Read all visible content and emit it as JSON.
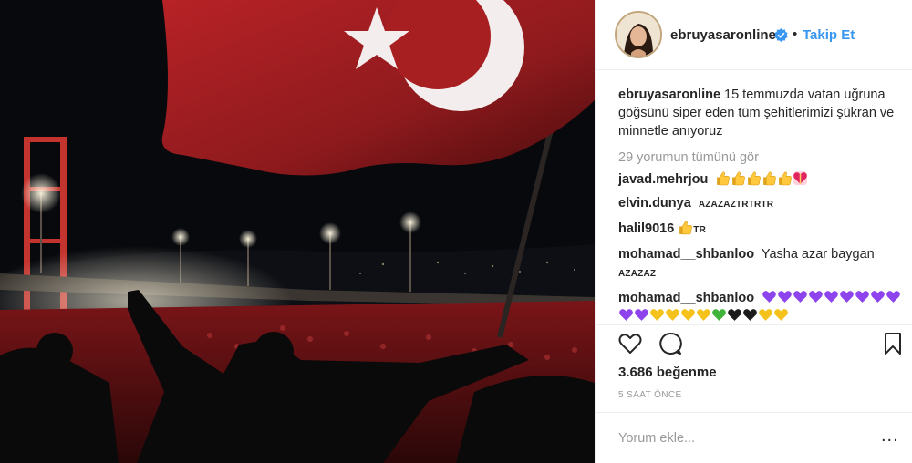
{
  "post": {
    "image_alt": "Turkish flag waved over a crowd on the bridge at night"
  },
  "header": {
    "username": "ebruyasaronline",
    "dot": "•",
    "follow_label": "Takip Et"
  },
  "caption": {
    "username": "ebruyasaronline",
    "text": "15 temmuzda vatan uğruna göğsünü siper eden tüm şehitlerimizi şükran ve minnetle anıyoruz"
  },
  "view_all_comments": "29 yorumun tümünü gör",
  "comments": [
    {
      "username": "javad.mehrjou",
      "text": "",
      "emojis": [
        "thumbs-up",
        "thumbs-up",
        "thumbs-up",
        "thumbs-up",
        "thumbs-up",
        "heart-ribbon"
      ]
    },
    {
      "username": "elvin.dunya",
      "text": "AZAZAZTRTRTR",
      "emojis": []
    },
    {
      "username": "halil9016",
      "text": "TR",
      "emojis": [
        "thumbs-up"
      ]
    },
    {
      "username": "mohamad__shbanloo",
      "text": "Yasha azar baygan",
      "text2": "AZAZAZ",
      "emojis": []
    },
    {
      "username": "mohamad__shbanloo",
      "text": "",
      "emojis": [
        "purple-heart",
        "purple-heart",
        "purple-heart",
        "purple-heart",
        "purple-heart",
        "purple-heart",
        "purple-heart",
        "purple-heart",
        "purple-heart",
        "purple-heart",
        "purple-heart",
        "yellow-heart",
        "yellow-heart",
        "yellow-heart",
        "yellow-heart",
        "green-heart",
        "black-heart",
        "black-heart",
        "yellow-heart",
        "yellow-heart"
      ]
    }
  ],
  "likes": "3.686 beğenme",
  "time_ago": "5 SAAT ÖNCE",
  "add_comment": {
    "placeholder": "Yorum ekle...",
    "more_label": "..."
  },
  "colors": {
    "link_blue": "#3897f0",
    "verified_blue": "#3897f0",
    "text": "#262626",
    "muted": "#999999",
    "border": "#efefef",
    "flag_red": "#9e1d1f"
  }
}
